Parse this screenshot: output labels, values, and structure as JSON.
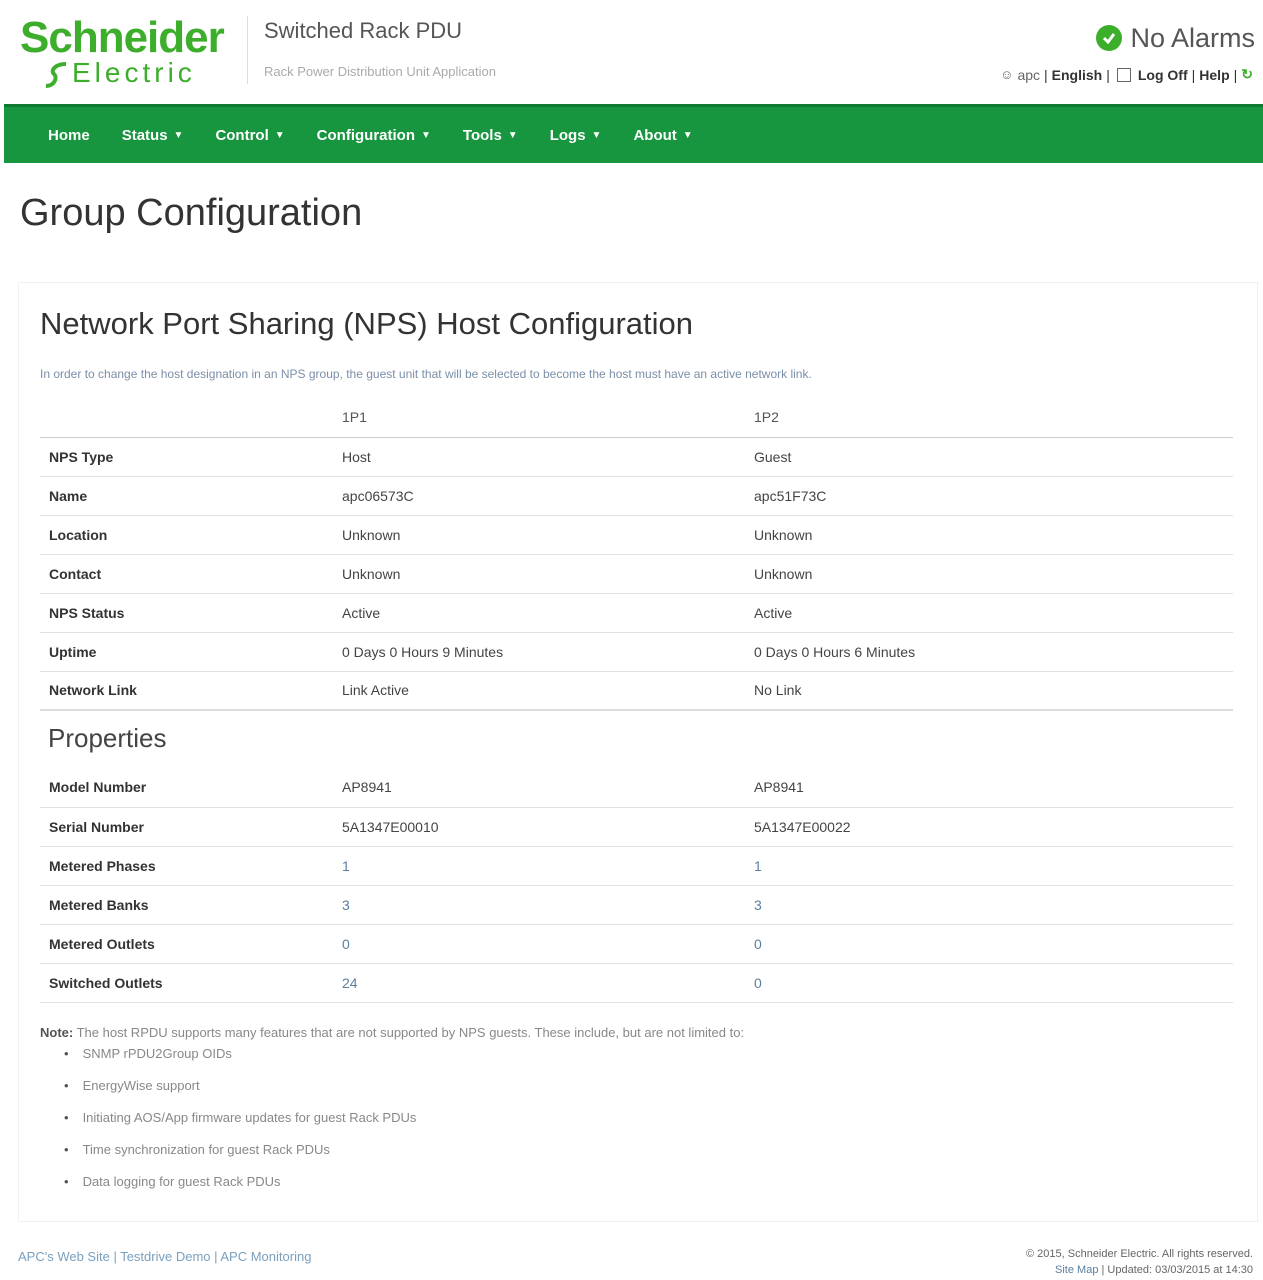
{
  "header": {
    "brand_top": "Schneider",
    "brand_bottom": "Electric",
    "app_title": "Switched Rack PDU",
    "app_subtitle": "Rack Power Distribution Unit Application",
    "alarm_status": "No Alarms",
    "util_links": {
      "user": "apc",
      "language": "English",
      "logoff": "Log Off",
      "help": "Help"
    }
  },
  "nav": {
    "items": [
      {
        "label": "Home",
        "has_caret": false
      },
      {
        "label": "Status",
        "has_caret": true
      },
      {
        "label": "Control",
        "has_caret": true
      },
      {
        "label": "Configuration",
        "has_caret": true
      },
      {
        "label": "Tools",
        "has_caret": true
      },
      {
        "label": "Logs",
        "has_caret": true
      },
      {
        "label": "About",
        "has_caret": true
      }
    ]
  },
  "page": {
    "title": "Group Configuration"
  },
  "nps": {
    "title": "Network Port Sharing (NPS) Host Configuration",
    "intro": "In order to change the host designation in an NPS group, the guest unit that will be selected to become the host must have an active network link.",
    "columns": [
      "1P1",
      "1P2"
    ],
    "rows": [
      {
        "label": "NPS Type",
        "v1": "Host",
        "v2": "Guest"
      },
      {
        "label": "Name",
        "v1": "apc06573C",
        "v2": "apc51F73C"
      },
      {
        "label": "Location",
        "v1": "Unknown",
        "v2": "Unknown"
      },
      {
        "label": "Contact",
        "v1": "Unknown",
        "v2": "Unknown"
      },
      {
        "label": "NPS Status",
        "v1": "Active",
        "v2": "Active"
      },
      {
        "label": "Uptime",
        "v1": "0 Days 0 Hours 9 Minutes",
        "v2": "0 Days 0 Hours 6 Minutes"
      },
      {
        "label": "Network Link",
        "v1": "Link Active",
        "v2": "No Link"
      }
    ]
  },
  "properties": {
    "title": "Properties",
    "rows": [
      {
        "label": "Model Number",
        "v1": "AP8941",
        "v2": "AP8941"
      },
      {
        "label": "Serial Number",
        "v1": "5A1347E00010",
        "v2": "5A1347E00022"
      },
      {
        "label": "Metered Phases",
        "v1": "1",
        "v2": "1"
      },
      {
        "label": "Metered Banks",
        "v1": "3",
        "v2": "3"
      },
      {
        "label": "Metered Outlets",
        "v1": "0",
        "v2": "0"
      },
      {
        "label": "Switched Outlets",
        "v1": "24",
        "v2": "0"
      }
    ]
  },
  "note": {
    "label": "Note:",
    "text": "The host RPDU supports many features that are not supported by NPS guests. These include, but are not limited to:",
    "bullets": [
      "SNMP rPDU2Group OIDs",
      "EnergyWise support",
      "Initiating AOS/App firmware updates for guest Rack PDUs",
      "Time synchronization for guest Rack PDUs",
      "Data logging for guest Rack PDUs"
    ]
  },
  "footer": {
    "links": "APC's Web Site | Testdrive Demo | APC Monitoring",
    "copyright": "© 2015, Schneider Electric. All rights reserved.",
    "sitemap": "Site Map",
    "updated": "| Updated: 03/03/2015 at 14:30"
  },
  "colors": {
    "brand_green": "#3dae2b",
    "nav_green": "#17953f"
  }
}
